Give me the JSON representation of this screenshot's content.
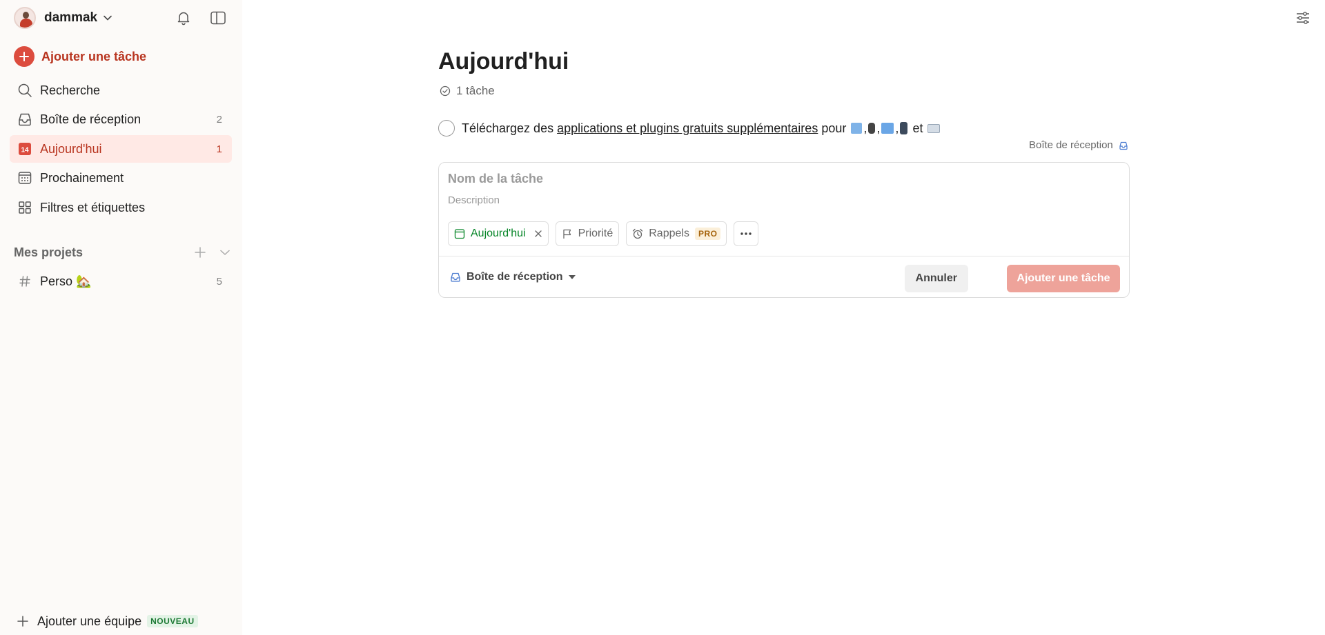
{
  "user": {
    "name": "dammak"
  },
  "sidebar": {
    "add_task_label": "Ajouter une tâche",
    "items": [
      {
        "label": "Recherche",
        "icon": "search-icon",
        "count": ""
      },
      {
        "label": "Boîte de réception",
        "icon": "inbox-icon",
        "count": "2"
      },
      {
        "label": "Aujourd'hui",
        "icon": "calendar-today-icon",
        "count": "1",
        "day": "14",
        "active": true
      },
      {
        "label": "Prochainement",
        "icon": "calendar-grid-icon",
        "count": ""
      },
      {
        "label": "Filtres et étiquettes",
        "icon": "grid-icon",
        "count": ""
      }
    ],
    "projects_label": "Mes projets",
    "projects": [
      {
        "label": "Perso 🏡",
        "count": "5"
      }
    ],
    "team_label": "Ajouter une équipe",
    "team_badge": "NOUVEAU"
  },
  "main": {
    "title": "Aujourd'hui",
    "task_count": "1 tâche",
    "task": {
      "prefix": "Téléchargez des",
      "link": "applications et plugins gratuits supplémentaires",
      "middle": "pour",
      "sep1": ",",
      "sep2": ",",
      "sep3": ",",
      "and": "et",
      "project": "Boîte de réception"
    },
    "editor": {
      "name_placeholder": "Nom de la tâche",
      "desc_placeholder": "Description",
      "chip_today": "Aujourd'hui",
      "chip_priority": "Priorité",
      "chip_reminders": "Rappels",
      "pro_badge": "PRO",
      "project": "Boîte de réception",
      "cancel": "Annuler",
      "submit": "Ajouter une tâche"
    }
  },
  "colors": {
    "accent": "#dc4c3e",
    "accent_text": "#b8341f",
    "active_bg": "#ffe9e5",
    "today_green": "#058527",
    "submit_disabled": "#eea39a"
  }
}
